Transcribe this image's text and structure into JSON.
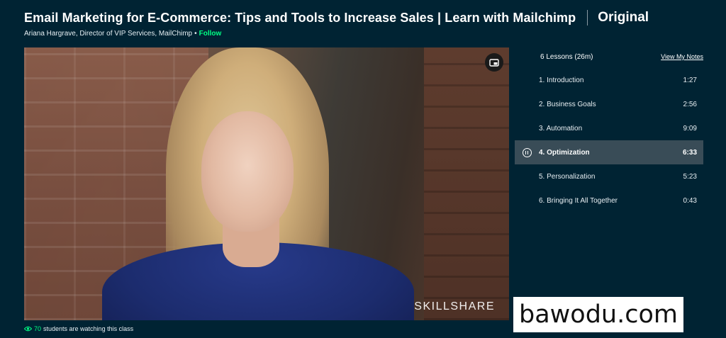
{
  "header": {
    "title": "Email Marketing for E-Commerce: Tips and Tools to Increase Sales | Learn with Mailchimp",
    "badge": "Original",
    "teacher": "Ariana Hargrave, Director of VIP Services, MailChimp",
    "separator": "•",
    "follow_label": "Follow"
  },
  "video": {
    "watermark": "SKILLSHARE",
    "pip_icon": "picture-in-picture-icon"
  },
  "watching": {
    "count": "70",
    "label": "students are watching this class",
    "icon": "eye-icon"
  },
  "sidebar": {
    "summary": "6 Lessons (26m)",
    "notes_link": "View My Notes",
    "lessons": [
      {
        "title": "1. Introduction",
        "duration": "1:27"
      },
      {
        "title": "2. Business Goals",
        "duration": "2:56"
      },
      {
        "title": "3. Automation",
        "duration": "9:09"
      },
      {
        "title": "4. Optimization",
        "duration": "6:33"
      },
      {
        "title": "5. Personalization",
        "duration": "5:23"
      },
      {
        "title": "6. Bringing It All Together",
        "duration": "0:43"
      }
    ],
    "active_index": 3
  },
  "site_watermark": "bawodu.com",
  "colors": {
    "background": "#002333",
    "accent": "#00ff84",
    "active_row": "#394c57"
  }
}
